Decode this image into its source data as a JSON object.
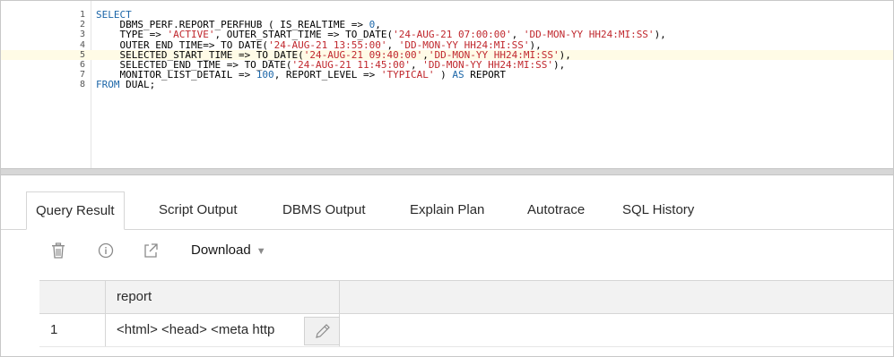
{
  "editor": {
    "lines": [
      {
        "num": "1",
        "tokens": [
          {
            "t": "SELECT",
            "c": "kw"
          }
        ]
      },
      {
        "num": "2",
        "tokens": [
          {
            "t": "    DBMS_PERF.REPORT_PERFHUB ( IS_REALTIME => ",
            "c": ""
          },
          {
            "t": "0",
            "c": "num"
          },
          {
            "t": ",",
            "c": ""
          }
        ]
      },
      {
        "num": "3",
        "tokens": [
          {
            "t": "    TYPE => ",
            "c": ""
          },
          {
            "t": "'ACTIVE'",
            "c": "str"
          },
          {
            "t": ", OUTER_START_TIME => TO_DATE(",
            "c": ""
          },
          {
            "t": "'24-AUG-21 07:00:00'",
            "c": "str"
          },
          {
            "t": ", ",
            "c": ""
          },
          {
            "t": "'DD-MON-YY HH24:MI:SS'",
            "c": "str"
          },
          {
            "t": "),",
            "c": ""
          }
        ]
      },
      {
        "num": "4",
        "tokens": [
          {
            "t": "    OUTER_END_TIME=> TO_DATE(",
            "c": ""
          },
          {
            "t": "'24-AUG-21 13:55:00'",
            "c": "str"
          },
          {
            "t": ", ",
            "c": ""
          },
          {
            "t": "'DD-MON-YY HH24:MI:SS'",
            "c": "str"
          },
          {
            "t": "),",
            "c": ""
          }
        ]
      },
      {
        "num": "5",
        "tokens": [
          {
            "t": "    SELECTED_START_TIME => TO_DATE(",
            "c": ""
          },
          {
            "t": "'24-AUG-21 09:40:00'",
            "c": "str"
          },
          {
            "t": ",",
            "c": ""
          },
          {
            "t": "'DD-MON-YY HH24:MI:SS'",
            "c": "str"
          },
          {
            "t": "),",
            "c": ""
          }
        ],
        "highlight": true
      },
      {
        "num": "6",
        "tokens": [
          {
            "t": "    SELECTED_END_TIME => TO_DATE(",
            "c": ""
          },
          {
            "t": "'24-AUG-21 11:45:00'",
            "c": "str"
          },
          {
            "t": ", ",
            "c": ""
          },
          {
            "t": "'DD-MON-YY HH24:MI:SS'",
            "c": "str"
          },
          {
            "t": "),",
            "c": ""
          }
        ]
      },
      {
        "num": "7",
        "tokens": [
          {
            "t": "    MONITOR_LIST_DETAIL => ",
            "c": ""
          },
          {
            "t": "100",
            "c": "num"
          },
          {
            "t": ", REPORT_LEVEL => ",
            "c": ""
          },
          {
            "t": "'TYPICAL'",
            "c": "str"
          },
          {
            "t": " ) ",
            "c": ""
          },
          {
            "t": "AS",
            "c": "kw"
          },
          {
            "t": " REPORT",
            "c": ""
          }
        ]
      },
      {
        "num": "8",
        "tokens": [
          {
            "t": "FROM",
            "c": "kw"
          },
          {
            "t": " DUAL;",
            "c": ""
          }
        ]
      }
    ]
  },
  "tabs": [
    {
      "label": "Query Result",
      "active": true
    },
    {
      "label": "Script Output"
    },
    {
      "label": "DBMS Output"
    },
    {
      "label": "Explain Plan"
    },
    {
      "label": "Autotrace"
    },
    {
      "label": "SQL History"
    }
  ],
  "toolbar": {
    "delete_icon": "trash-icon",
    "info_icon": "info-icon",
    "open_icon": "external-link-icon",
    "download_label": "Download"
  },
  "grid": {
    "columns": [
      "report"
    ],
    "rows": [
      {
        "num": "1",
        "report": "<html> <head> <meta http"
      }
    ]
  },
  "colors": {
    "keyword": "#1c66a8",
    "string": "#c0272d",
    "highlight_line": "#fffbe6"
  }
}
